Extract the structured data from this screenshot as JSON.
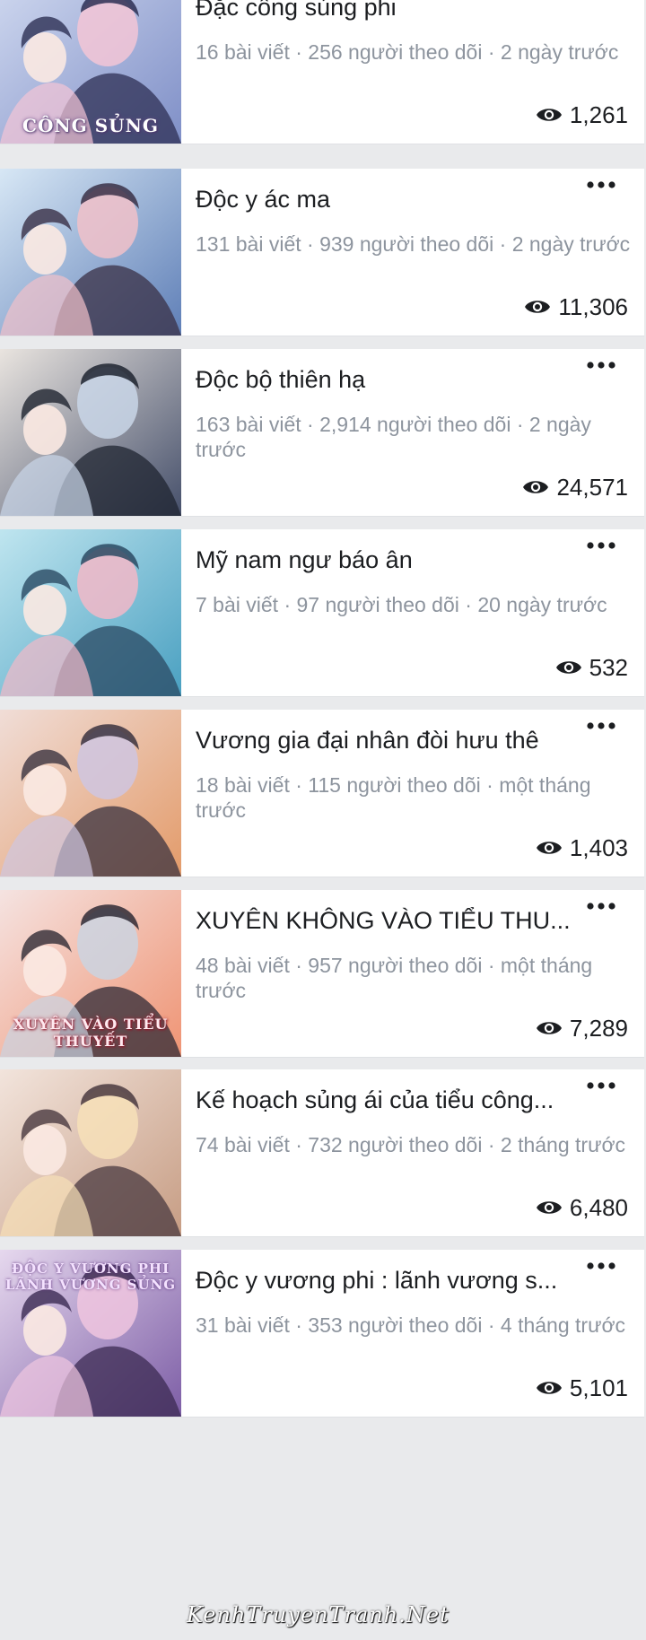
{
  "colors": {
    "background": "#e9eaec",
    "card": "#ffffff",
    "title": "#1c1e21",
    "meta": "#8d949e"
  },
  "icons": {
    "more": "more-horizontal-icon",
    "views": "eye-icon"
  },
  "groups": [
    {
      "title": "Đặc công sủng phi",
      "meta": "16 bài viết · 256 người theo dõi · 2 ngày trước",
      "views": "1,261",
      "cover_text": "CÔNG SỦNG"
    },
    {
      "title": "Độc y ác ma",
      "meta": "131 bài viết · 939 người theo dõi · 2 ngày trước",
      "views": "11,306",
      "cover_text": ""
    },
    {
      "title": "Độc bộ thiên hạ",
      "meta": "163 bài viết · 2,914 người theo dõi · 2 ngày trước",
      "views": "24,571",
      "cover_text": ""
    },
    {
      "title": "Mỹ nam ngư báo ân",
      "meta": "7 bài viết · 97 người theo dõi · 20 ngày trước",
      "views": "532",
      "cover_text": ""
    },
    {
      "title": "Vương gia đại nhân đòi hưu thê",
      "meta": "18 bài viết · 115 người theo dõi · một tháng trước",
      "views": "1,403",
      "cover_text": ""
    },
    {
      "title": "XUYÊN KHÔNG VÀO TIỂU THU...",
      "meta": "48 bài viết · 957 người theo dõi · một tháng trước",
      "views": "7,289",
      "cover_text": "XUYÊN VÀO TIỂU THUYẾT"
    },
    {
      "title": "Kế hoạch sủng ái của tiểu công...",
      "meta": "74 bài viết · 732 người theo dõi · 2 tháng trước",
      "views": "6,480",
      "cover_text": ""
    },
    {
      "title": "Độc y vương phi : lãnh vương s...",
      "meta": "31 bài viết · 353 người theo dõi · 4 tháng trước",
      "views": "5,101",
      "cover_text": "ĐỘC Y VƯƠNG PHI LÃNH VƯƠNG SỦNG"
    }
  ],
  "watermark": "KenhTruyenTranh.Net"
}
